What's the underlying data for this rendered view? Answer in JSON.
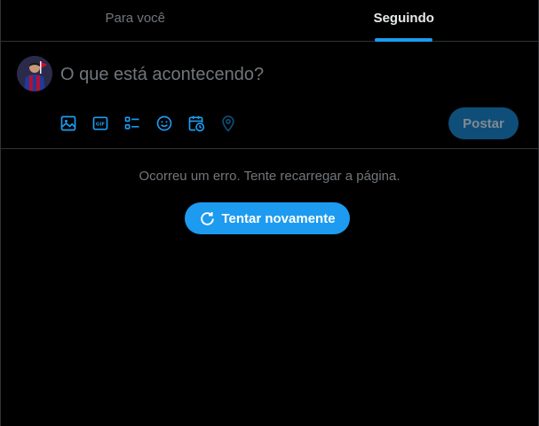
{
  "tabs": [
    {
      "label": "Para você",
      "active": false
    },
    {
      "label": "Seguindo",
      "active": true
    }
  ],
  "composer": {
    "placeholder": "O que está acontecendo?",
    "tools": [
      "image-icon",
      "gif-icon",
      "poll-icon",
      "emoji-icon",
      "schedule-icon",
      "location-icon"
    ],
    "post_label": "Postar"
  },
  "feed": {
    "error_message": "Ocorreu um erro. Tente recarregar a página.",
    "retry_label": "Tentar novamente"
  },
  "colors": {
    "accent": "#1d9bf0",
    "muted_text": "#71767b",
    "divider": "#2f3336",
    "post_disabled_bg": "#0f4e78"
  }
}
